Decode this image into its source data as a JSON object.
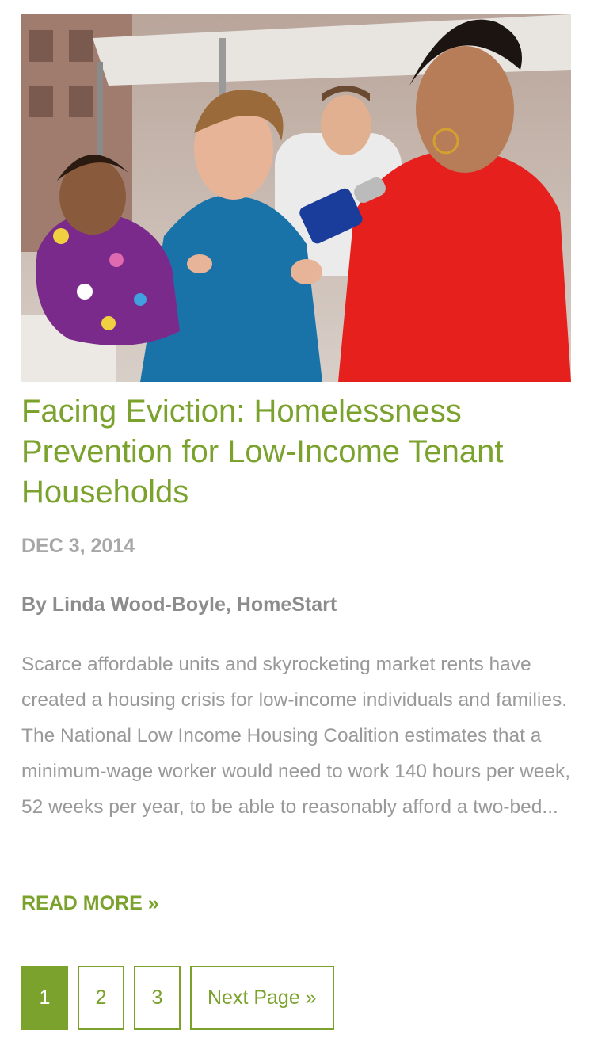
{
  "post": {
    "image": {
      "alt_subject": "photo-woman-holding-child-interviewed-by-reporter"
    },
    "title": "Facing Eviction: Homelessness Prevention for Low-Income Tenant Households",
    "date": "DEC 3, 2014",
    "byline": "By Linda Wood-Boyle, HomeStart",
    "excerpt": "Scarce affordable units and skyrocketing market rents have created a housing crisis for low-income individuals and families. The National Low Income Housing Coalition estimates that a minimum-wage worker would need to work 140 hours per week, 52 weeks per year, to be able to reasonably afford a two-bed...",
    "read_more": "READ MORE »"
  },
  "pagination": {
    "pages": [
      "1",
      "2",
      "3"
    ],
    "current": "1",
    "next_label": "Next Page »"
  },
  "colors": {
    "accent": "#7aa22c",
    "date_text": "#a7a7a7",
    "byline_text": "#8c8c8c",
    "body_text": "#999999"
  }
}
